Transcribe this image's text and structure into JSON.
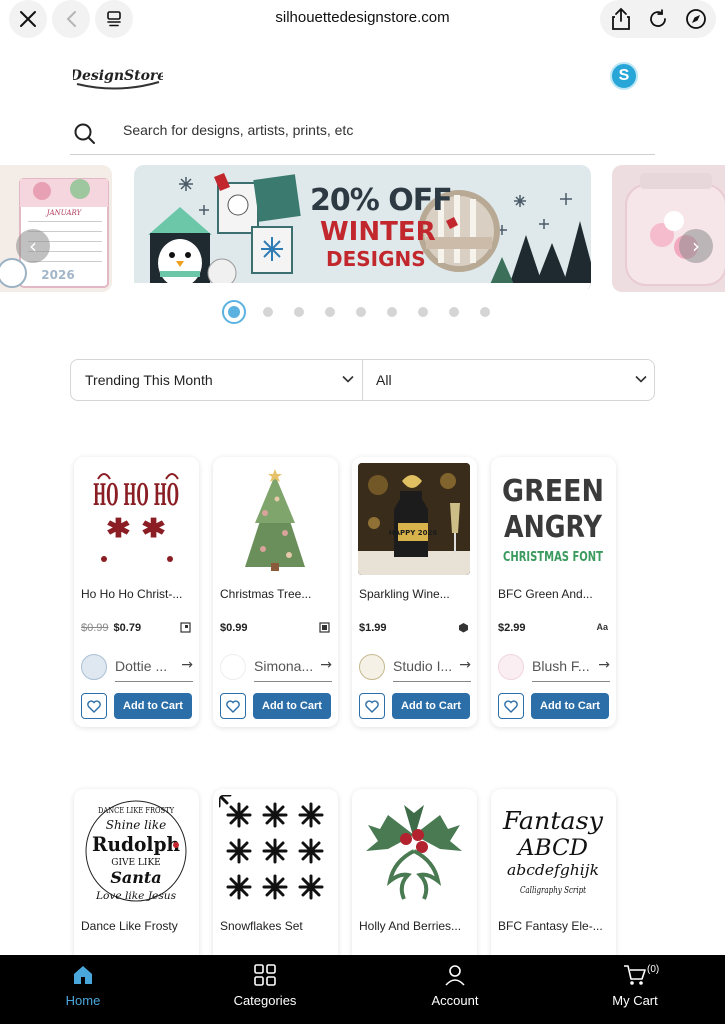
{
  "browser": {
    "url": "silhouettedesignstore.com"
  },
  "header": {
    "logo_text": "DesignStore",
    "account_avatar_letter": "S"
  },
  "search": {
    "placeholder": "Search for designs, artists, prints, etc"
  },
  "banner": {
    "headline": "20% OFF",
    "line2": "WINTER",
    "line3": "DESIGNS",
    "dots_count": 9,
    "active_dot": 1,
    "left_slide_label": "JANUARY",
    "left_slide_year": "2026"
  },
  "filters": {
    "sort": "Trending This Month",
    "category": "All"
  },
  "products": [
    {
      "title": "Ho Ho Ho Christ-...",
      "old_price": "$0.99",
      "price": "$0.79",
      "designer": "Dottie ...",
      "add_label": "Add to Cart",
      "thumb_text": "HO HO HO"
    },
    {
      "title": "Christmas Tree...",
      "old_price": "",
      "price": "$0.99",
      "designer": "Simona...",
      "add_label": "Add to Cart"
    },
    {
      "title": "Sparkling Wine...",
      "old_price": "",
      "price": "$1.99",
      "designer": "Studio I...",
      "add_label": "Add to Cart",
      "thumb_text": "HAPPY 2026"
    },
    {
      "title": "BFC Green And...",
      "old_price": "",
      "price": "$2.99",
      "designer": "Blush F...",
      "add_label": "Add to Cart",
      "type_label": "Aa",
      "thumb_line1": "GREEN",
      "thumb_line2": "ANGRY",
      "thumb_line3": "CHRISTMAS FONT"
    },
    {
      "title": "Dance Like Frosty",
      "thumb_line1": "DANCE LIKE FROSTY",
      "thumb_line2": "Shine like",
      "thumb_line3": "Rudolph",
      "thumb_line4": "GIVE LIKE",
      "thumb_line5": "Santa",
      "thumb_line6": "Love like Jesus"
    },
    {
      "title": "Snowflakes Set"
    },
    {
      "title": "Holly And Berries..."
    },
    {
      "title": "BFC Fantasy Ele-...",
      "thumb_line1": "Fantasy",
      "thumb_line2": "ABCD",
      "thumb_line3": "abcdefghijk",
      "thumb_line4": "Calligraphy Script"
    }
  ],
  "bottom_nav": {
    "home": "Home",
    "categories": "Categories",
    "account": "Account",
    "cart": "My Cart",
    "cart_count": "(0)"
  },
  "colors": {
    "accent": "#2c6fa8",
    "active_nav": "#4aa7dc",
    "banner_red": "#c1272d"
  }
}
